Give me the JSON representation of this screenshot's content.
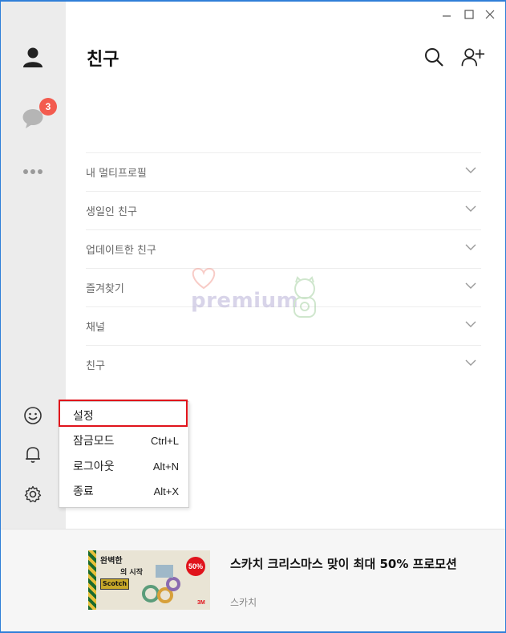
{
  "window": {
    "controls": [
      "minimize",
      "maximize",
      "close"
    ]
  },
  "sidebar": {
    "items": [
      {
        "icon": "person-icon"
      },
      {
        "icon": "chat-bubble-icon",
        "badge": "3"
      },
      {
        "icon": "more-icon"
      }
    ],
    "bottom": [
      {
        "icon": "emoji-icon"
      },
      {
        "icon": "bell-icon"
      },
      {
        "icon": "gear-icon"
      }
    ]
  },
  "header": {
    "title": "친구"
  },
  "sections": [
    {
      "label": "내 멀티프로필"
    },
    {
      "label": "생일인 친구"
    },
    {
      "label": "업데이트한 친구"
    },
    {
      "label": "즐겨찾기"
    },
    {
      "label": "채널"
    },
    {
      "label": "친구"
    }
  ],
  "watermark": {
    "text": "premium"
  },
  "settings_menu": {
    "items": [
      {
        "label": "설정",
        "shortcut": ""
      },
      {
        "label": "잠금모드",
        "shortcut": "Ctrl+L"
      },
      {
        "label": "로그아웃",
        "shortcut": "Alt+N"
      },
      {
        "label": "종료",
        "shortcut": "Alt+X"
      }
    ],
    "highlight_color": "#e0131b"
  },
  "ad": {
    "title": "스카치 크리스마스 맞이 최대 50% 프로모션",
    "advertiser": "스카치",
    "image": {
      "headline": "완벽한",
      "line2": "의 시작",
      "brand": "Scotch",
      "discount": "50%",
      "corner": "3M"
    }
  },
  "colors": {
    "accent": "#2f7fd8",
    "badge": "#f35b4f",
    "sidebar_bg": "#ececec"
  }
}
